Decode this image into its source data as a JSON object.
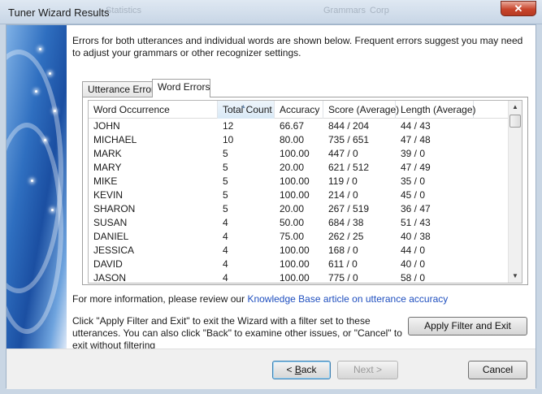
{
  "window": {
    "title": "Tuner Wizard Results",
    "close_glyph": "✕",
    "background_text": [
      "Statistics",
      "Grammars",
      "Corp"
    ]
  },
  "intro_text": "Errors for both utterances and individual words are shown below. Frequent errors suggest you may need to adjust your grammars or other recognizer settings.",
  "tabs": [
    {
      "label": "Utterance Errors",
      "active": false
    },
    {
      "label": "Word Errors",
      "active": true
    }
  ],
  "grid": {
    "columns": [
      "Word Occurrence",
      "Total Count",
      "Accuracy",
      "Score (Average)",
      "Length (Average)"
    ],
    "sorted_column": "Total Count",
    "rows": [
      [
        "JOHN",
        "12",
        "66.67",
        "844 / 204",
        "44 / 43"
      ],
      [
        "MICHAEL",
        "10",
        "80.00",
        "735 / 651",
        "47 / 48"
      ],
      [
        "MARK",
        "5",
        "100.00",
        "447 / 0",
        "39 / 0"
      ],
      [
        "MARY",
        "5",
        "20.00",
        "621 / 512",
        "47 / 49"
      ],
      [
        "MIKE",
        "5",
        "100.00",
        "119 / 0",
        "35 / 0"
      ],
      [
        "KEVIN",
        "5",
        "100.00",
        "214 / 0",
        "45 / 0"
      ],
      [
        "SHARON",
        "5",
        "20.00",
        "267 / 519",
        "36 / 47"
      ],
      [
        "SUSAN",
        "4",
        "50.00",
        "684 / 38",
        "51 / 43"
      ],
      [
        "DANIEL",
        "4",
        "75.00",
        "262 / 25",
        "40 / 38"
      ],
      [
        "JESSICA",
        "4",
        "100.00",
        "168 / 0",
        "44 / 0"
      ],
      [
        "DAVID",
        "4",
        "100.00",
        "611 / 0",
        "40 / 0"
      ],
      [
        "JASON",
        "4",
        "100.00",
        "775 / 0",
        "58 / 0"
      ]
    ]
  },
  "info": {
    "prefix": "For more information, please review our",
    "link_text": "Knowledge Base article on utterance accuracy"
  },
  "apply_text": "Click \"Apply Filter and Exit\" to exit the Wizard with a filter set to these utterances. You can also click \"Back\" to examine other issues, or \"Cancel\" to exit without filtering",
  "buttons": {
    "apply": "Apply Filter and Exit",
    "back_pre": "< ",
    "back_accel": "B",
    "back_post": "ack",
    "next": "Next >",
    "cancel": "Cancel"
  },
  "colors": {
    "link": "#1f4fbf",
    "disabled_text": "#9b9b9b",
    "title_bar": "#c8d6e6",
    "close_button": "#c8452c"
  },
  "icons": [
    "close-icon",
    "scroll-up-icon",
    "scroll-down-icon",
    "sort-ascending-icon"
  ]
}
